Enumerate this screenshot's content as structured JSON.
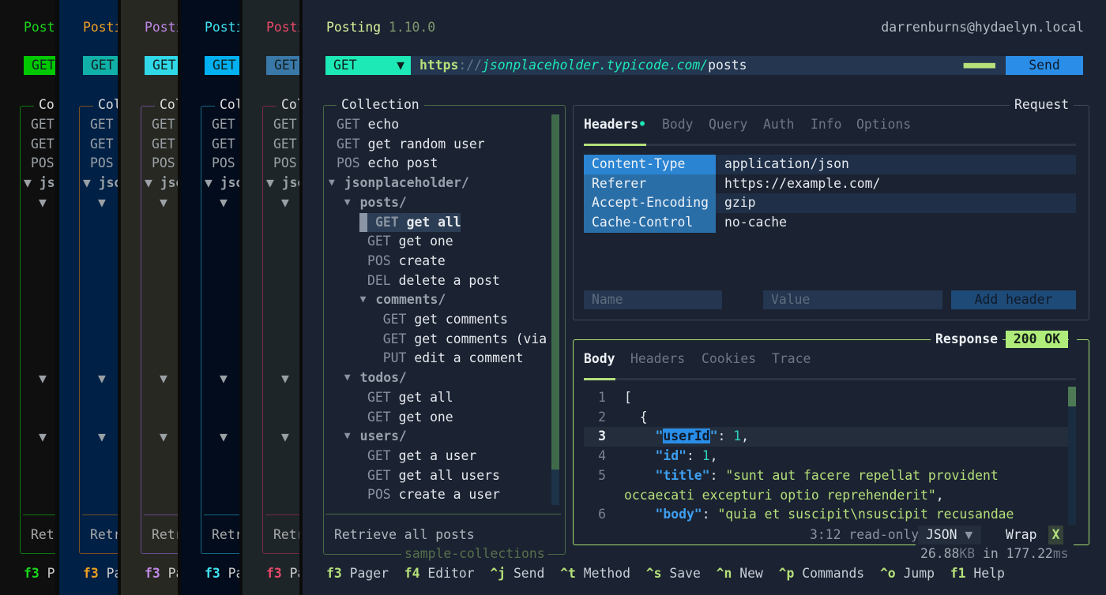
{
  "background_instances": [
    {
      "title": "Posting",
      "method": "GET",
      "collection": "Collection",
      "items": [
        "GET",
        "GET",
        "POS"
      ],
      "folder": "jsonplaceholder/",
      "footer_text": "Retrieve all posts",
      "key": "f3",
      "key_label": "Pager",
      "accent": "#19d919",
      "chip": "#00c800",
      "bg": "#0f0f0f",
      "border": "#0d7a0d"
    },
    {
      "title": "Posting",
      "method": "GET",
      "collection": "Collection",
      "items": [
        "GET",
        "GET",
        "POS"
      ],
      "folder": "jsonplaceholder/",
      "footer_text": "Retrieve all posts",
      "key": "f3",
      "key_label": "Pager",
      "accent": "#f0a020",
      "chip": "#10b0a8",
      "bg": "#002045",
      "border": "#7a5020"
    },
    {
      "title": "Posting",
      "method": "GET",
      "collection": "Collection",
      "items": [
        "GET",
        "GET",
        "POS"
      ],
      "folder": "jsonplaceholder/",
      "footer_text": "Retrieve all posts",
      "key": "f3",
      "key_label": "Pager",
      "accent": "#c088e8",
      "chip": "#30d8e8",
      "bg": "#272822",
      "border": "#6a4a90"
    },
    {
      "title": "Posting",
      "method": "GET",
      "collection": "Collection",
      "items": [
        "GET",
        "GET",
        "POS"
      ],
      "folder": "jsonplaceholder/",
      "footer_text": "Retrieve all posts",
      "key": "f3",
      "key_label": "Pager",
      "accent": "#40e4f0",
      "chip": "#00b0f0",
      "bg": "#020c1c",
      "border": "#156a85"
    },
    {
      "title": "Posting",
      "method": "GET",
      "collection": "Collection",
      "items": [
        "GET",
        "GET",
        "POS"
      ],
      "folder": "jsonplaceholder/",
      "footer_text": "Retrieve all posts",
      "key": "f3",
      "key_label": "Pager",
      "accent": "#e84a68",
      "chip": "#3a78a8",
      "bg": "#1e2529",
      "border": "#7a2a40"
    }
  ],
  "header": {
    "app_name": "Posting",
    "version": "1.10.0",
    "user": "darrenburns@hydaelyn.local"
  },
  "url_bar": {
    "method": "GET",
    "method_icon": "triangle-down",
    "scheme": "https",
    "separator": "://",
    "host": "jsonplaceholder.typicode.com/",
    "path": "posts",
    "progress": "■■■■■■■",
    "send_label": "Send"
  },
  "collection": {
    "title": "Collection",
    "items": [
      {
        "depth": 0,
        "type": "request",
        "method": "GET",
        "name": "echo"
      },
      {
        "depth": 0,
        "type": "request",
        "method": "GET",
        "name": "get random user"
      },
      {
        "depth": 0,
        "type": "request",
        "method": "POS",
        "name": "echo post"
      },
      {
        "depth": 0,
        "type": "folder",
        "name": "jsonplaceholder/"
      },
      {
        "depth": 1,
        "type": "folder",
        "name": "posts/"
      },
      {
        "depth": 2,
        "type": "request",
        "method": "GET",
        "name": "get all",
        "selected": true
      },
      {
        "depth": 2,
        "type": "request",
        "method": "GET",
        "name": "get one"
      },
      {
        "depth": 2,
        "type": "request",
        "method": "POS",
        "name": "create"
      },
      {
        "depth": 2,
        "type": "request",
        "method": "DEL",
        "name": "delete a post"
      },
      {
        "depth": 2,
        "type": "folder",
        "name": "comments/"
      },
      {
        "depth": 3,
        "type": "request",
        "method": "GET",
        "name": "get comments"
      },
      {
        "depth": 3,
        "type": "request",
        "method": "GET",
        "name": "get comments (via"
      },
      {
        "depth": 3,
        "type": "request",
        "method": "PUT",
        "name": "edit a comment"
      },
      {
        "depth": 1,
        "type": "folder",
        "name": "todos/"
      },
      {
        "depth": 2,
        "type": "request",
        "method": "GET",
        "name": "get all"
      },
      {
        "depth": 2,
        "type": "request",
        "method": "GET",
        "name": "get one"
      },
      {
        "depth": 1,
        "type": "folder",
        "name": "users/"
      },
      {
        "depth": 2,
        "type": "request",
        "method": "GET",
        "name": "get a user"
      },
      {
        "depth": 2,
        "type": "request",
        "method": "GET",
        "name": "get all users"
      },
      {
        "depth": 2,
        "type": "request",
        "method": "POS",
        "name": "create a user"
      }
    ],
    "description": "Retrieve all posts",
    "footer": "sample-collections"
  },
  "request": {
    "title": "Request",
    "tabs": [
      {
        "label": "Headers",
        "active": true,
        "dot": "•"
      },
      {
        "label": "Body"
      },
      {
        "label": "Query"
      },
      {
        "label": "Auth"
      },
      {
        "label": "Info"
      },
      {
        "label": "Options"
      }
    ],
    "headers": [
      {
        "name": "Content-Type",
        "value": "application/json"
      },
      {
        "name": "Referer",
        "value": "https://example.com/"
      },
      {
        "name": "Accept-Encoding",
        "value": "gzip"
      },
      {
        "name": "Cache-Control",
        "value": "no-cache"
      }
    ],
    "name_placeholder": "Name",
    "value_placeholder": "Value",
    "add_header_label": "Add header"
  },
  "response": {
    "title": "Response",
    "status": "200 OK",
    "tabs": [
      {
        "label": "Body",
        "active": true
      },
      {
        "label": "Headers"
      },
      {
        "label": "Cookies"
      },
      {
        "label": "Trace"
      }
    ],
    "lines": [
      {
        "num": "1",
        "tokens": [
          [
            "[",
            "p"
          ]
        ]
      },
      {
        "num": "2",
        "tokens": [
          [
            "  {",
            "p"
          ]
        ]
      },
      {
        "num": "3",
        "current": true,
        "tokens": [
          [
            "    \"",
            "k"
          ],
          [
            "userId",
            "sel"
          ],
          [
            "\"",
            "k"
          ],
          [
            ": ",
            "p"
          ],
          [
            "1",
            "n"
          ],
          [
            ",",
            "p"
          ]
        ]
      },
      {
        "num": "4",
        "tokens": [
          [
            "    \"id\"",
            "k"
          ],
          [
            ": ",
            "p"
          ],
          [
            "1",
            "n"
          ],
          [
            ",",
            "p"
          ]
        ]
      },
      {
        "num": "5",
        "tokens": [
          [
            "    \"title\"",
            "k"
          ],
          [
            ": ",
            "p"
          ],
          [
            "\"sunt aut facere repellat provident",
            "s"
          ]
        ]
      },
      {
        "num": "",
        "tokens": [
          [
            "occaecati excepturi optio reprehenderit\"",
            "s"
          ],
          [
            ",",
            "p"
          ]
        ]
      },
      {
        "num": "6",
        "tokens": [
          [
            "    \"body\"",
            "k"
          ],
          [
            ": ",
            "p"
          ],
          [
            "\"quia et suscipit\\nsuscipit recusandae",
            "s"
          ]
        ]
      }
    ],
    "cursor": "3:12",
    "mode": "read-only",
    "language": "JSON",
    "wrap_label": "Wrap",
    "wrap_toggle": "X",
    "size": "26.88",
    "size_unit": "KB",
    "in": "in",
    "time": "177.22",
    "time_unit": "ms"
  },
  "footer": [
    {
      "key": "f3",
      "label": "Pager"
    },
    {
      "key": "f4",
      "label": "Editor"
    },
    {
      "key": "^j",
      "label": "Send"
    },
    {
      "key": "^t",
      "label": "Method"
    },
    {
      "key": "^s",
      "label": "Save"
    },
    {
      "key": "^n",
      "label": "New"
    },
    {
      "key": "^p",
      "label": "Commands"
    },
    {
      "key": "^o",
      "label": "Jump"
    },
    {
      "key": "f1",
      "label": "Help"
    }
  ],
  "colors": {
    "accent": "#b5e07a",
    "method": "#1de9b6",
    "send": "#2a8ee8",
    "border": "#4a6a48",
    "response_border": "#a8e070"
  }
}
